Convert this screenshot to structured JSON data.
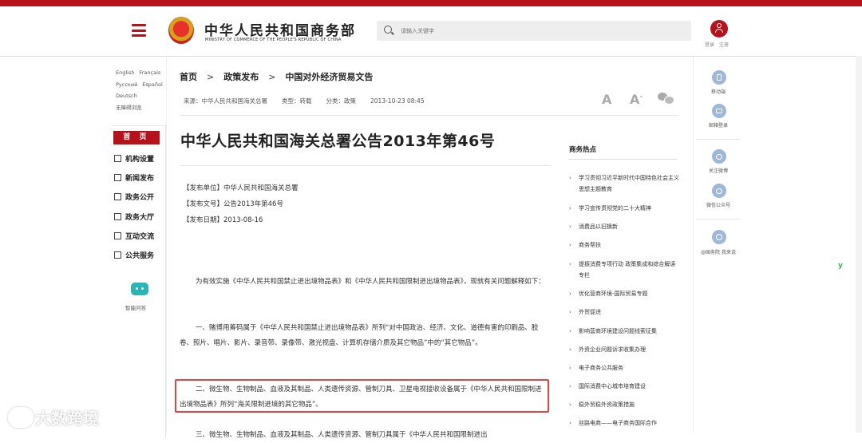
{
  "header": {
    "logo_cn": "中华人民共和国商务部",
    "logo_en": "MINISTRY OF COMMERCE OF THE PEOPLE'S REPUBLIC OF CHINA",
    "search_placeholder": "请输入关键字",
    "login": "登录",
    "register": "注册",
    "brand_color": "#b5121b"
  },
  "langs": {
    "english": "English",
    "francais": "Français",
    "russian": "Русский",
    "espanol": "Español",
    "deutsch": "Deutsch",
    "accessible": "无障碍浏览"
  },
  "leftnav": {
    "home": "首 页",
    "items": [
      "机构设置",
      "新闻发布",
      "政务公开",
      "政务大厅",
      "互动交流",
      "公共服务"
    ],
    "robot_label": "智能问答"
  },
  "breadcrumb": [
    "首页",
    "政策发布",
    "中国对外经济贸易文告"
  ],
  "meta": {
    "source": "来源：中华人民共和国海关总署",
    "type": "类型：转载",
    "category": "分类：政策",
    "date": "2013-10-23 08:45",
    "font_large": "A",
    "font_small": "A",
    "font_small_sup": "-"
  },
  "article": {
    "title": "中华人民共和国海关总署公告2013年第46号",
    "unit": "【发布单位】中华人民共和国海关总署",
    "doc_no": "【发布文号】公告2013年第46号",
    "pub_date": "【发布日期】2013-08-16",
    "p1": "为有效实施《中华人民共和国禁止进出境物品表》和《中华人民共和国限制进出境物品表》，现就有关问题解释如下：",
    "p2": "一、赌博用筹码属于《中华人民共和国禁止进出境物品表》所列“对中国政治、经济、文化、道德有害的印刷品、胶卷、照片、唱片、影片、录音带、录像带、激光视盘、计算机存储介质及其它物品”中的“其它物品”。",
    "p3": "二、微生物、生物制品、血液及其制品、人类遗传资源、管制刀具、卫星电视接收设备属于《中华人民共和国限制进出境物品表》所列“海关限制进境的其它物品”。",
    "p4": "三、微生物、生物制品、血液及其制品、人类遗传资源、管制刀具属于《中华人民共和国限制进出"
  },
  "sidebar": {
    "title": "商务热点",
    "items": [
      "学习贯彻习近平新时代中国特色社会主义思想主题教育",
      "学习宣传贯彻党的二十大精神",
      "消费品以旧换新",
      "商务帮扶",
      "提振消费专项行动 政策集成和综合解读专栏",
      "优化营商环境-国际贸易专题",
      "外贸促进",
      "影响营商环境建设问题线索征集",
      "外资企业问题诉求收集办理",
      "电子商务公共服务",
      "国际消费中心城市培育建设",
      "稳外贸稳外资政策措施",
      "丝路电商——电子商务国际合作"
    ]
  },
  "rightside": {
    "mobile": "移动端",
    "mail": "邮箱登录",
    "weibo": "关注微博",
    "wechat": "微信公众号",
    "ask": "@国务院 我来说"
  },
  "watermark": "大数跨境"
}
